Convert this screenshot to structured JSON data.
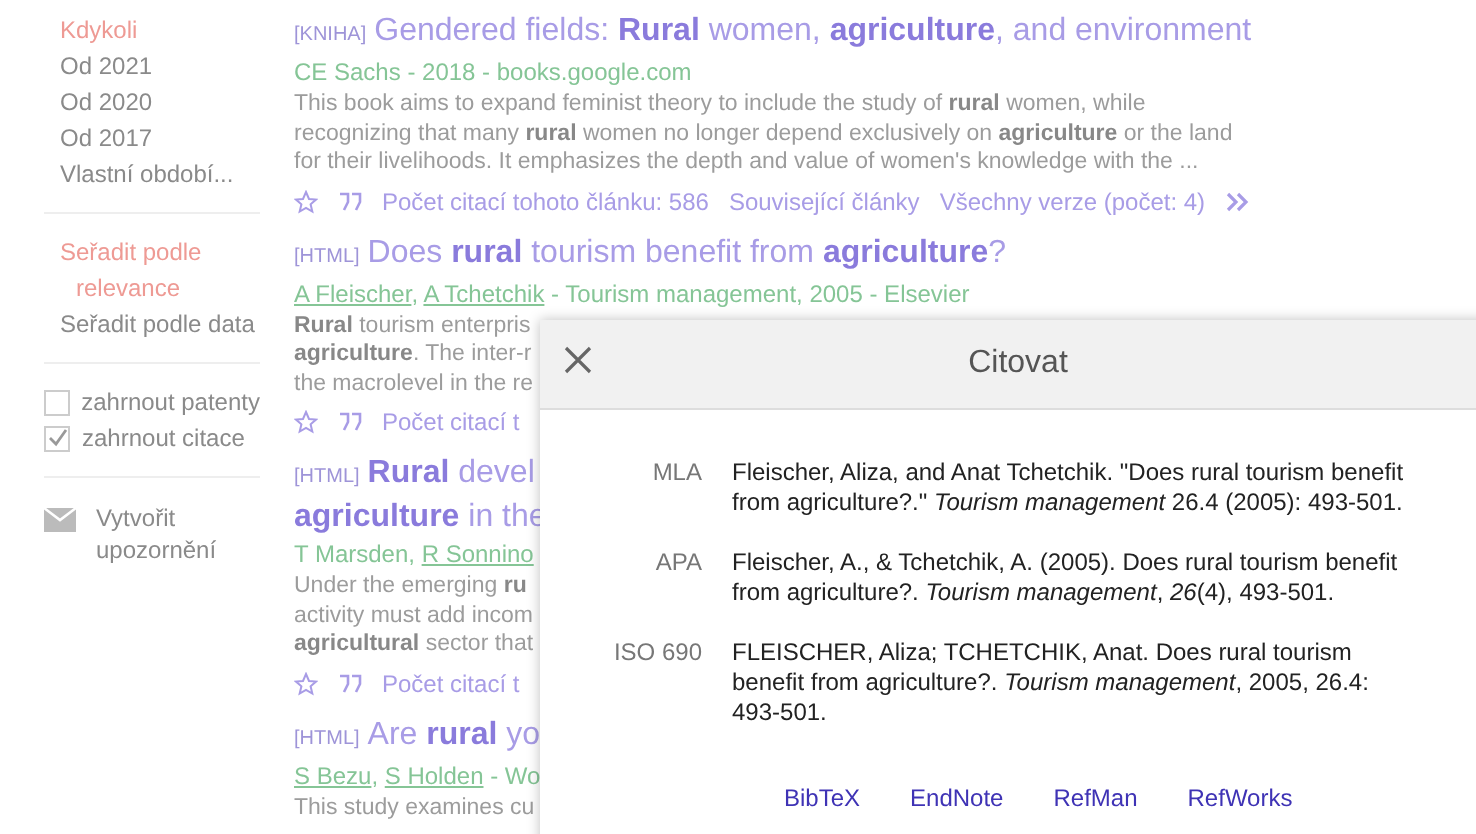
{
  "sidebar": {
    "time_filters": [
      {
        "label": "Kdykoli",
        "selected": true
      },
      {
        "label": "Od 2021",
        "selected": false
      },
      {
        "label": "Od 2020",
        "selected": false
      },
      {
        "label": "Od 2017",
        "selected": false
      },
      {
        "label": "Vlastní období...",
        "selected": false
      }
    ],
    "sort_options": [
      {
        "label": "Seřadit podle relevance",
        "selected": true
      },
      {
        "label": "Seřadit podle data",
        "selected": false
      }
    ],
    "checkboxes": [
      {
        "label": "zahrnout patenty",
        "checked": false
      },
      {
        "label": "zahrnout citace",
        "checked": true
      }
    ],
    "alert": {
      "label": "Vytvořit upozornění"
    }
  },
  "results": [
    {
      "tag": "[KNIHA]",
      "title_lines": [
        "Gendered fields: **Rural** women, **agriculture**, and environment"
      ],
      "byline": [
        {
          "text": "CE Sachs",
          "linked": false
        },
        {
          "text": " - 2018 - books.google.com",
          "linked": false
        }
      ],
      "snippet_lines": [
        "This book aims to expand feminist theory to include the study of **rural** women, while",
        "recognizing that many **rural** women no longer depend exclusively on **agriculture** or the land",
        "for their livelihoods. It emphasizes the depth and value of women's knowledge with the ..."
      ],
      "actions": [
        "Počet citací tohoto článku: 586",
        "Související články",
        "Všechny verze (počet: 4)"
      ],
      "show_more": true
    },
    {
      "tag": "[HTML]",
      "title_lines": [
        "Does **rural** tourism benefit from **agriculture**?"
      ],
      "byline": [
        {
          "text": "A Fleischer",
          "linked": true,
          "suffix": ", "
        },
        {
          "text": "A Tchetchik",
          "linked": true
        },
        {
          "text": " - Tourism management, 2005 - Elsevier",
          "linked": false
        }
      ],
      "snippet_lines": [
        "**Rural** tourism enterpris",
        "**agriculture**. The inter-r",
        "the macrolevel in the re"
      ],
      "actions": [
        "Počet citací t"
      ]
    },
    {
      "tag": "[HTML]",
      "title_lines": [
        "**Rural** devel",
        "**agriculture** in the"
      ],
      "byline": [
        {
          "text": "T Marsden",
          "linked": false,
          "suffix": ", "
        },
        {
          "text": "R Sonnino",
          "linked": true
        }
      ],
      "snippet_lines": [
        "Under the emerging **ru**",
        "activity must add incom",
        "**agricultural** sector that"
      ],
      "actions": [
        "Počet citací t"
      ]
    },
    {
      "tag": "[HTML]",
      "title_lines": [
        "Are **rural** yo"
      ],
      "byline": [
        {
          "text": "S Bezu",
          "linked": true,
          "suffix": ", "
        },
        {
          "text": "S Holden",
          "linked": true
        },
        {
          "text": " - Wo",
          "linked": false
        }
      ],
      "snippet_lines": [
        "This study examines cu"
      ]
    }
  ],
  "cite_dialog": {
    "title": "Citovat",
    "citations": [
      {
        "style": "MLA",
        "text": "Fleischer, Aliza, and Anat Tchetchik. \"Does rural tourism benefit from agriculture?.\" *Tourism management* 26.4 (2005): 493-501."
      },
      {
        "style": "APA",
        "text": "Fleischer, A., & Tchetchik, A. (2005). Does rural tourism benefit from agriculture?. *Tourism management*, *26*(4), 493-501."
      },
      {
        "style": "ISO 690",
        "text": "FLEISCHER, Aliza; TCHETCHIK, Anat. Does rural tourism benefit from agriculture?. *Tourism management*, 2005, 26.4: 493-501."
      }
    ],
    "export_links": [
      "BibTeX",
      "EndNote",
      "RefMan",
      "RefWorks"
    ]
  }
}
